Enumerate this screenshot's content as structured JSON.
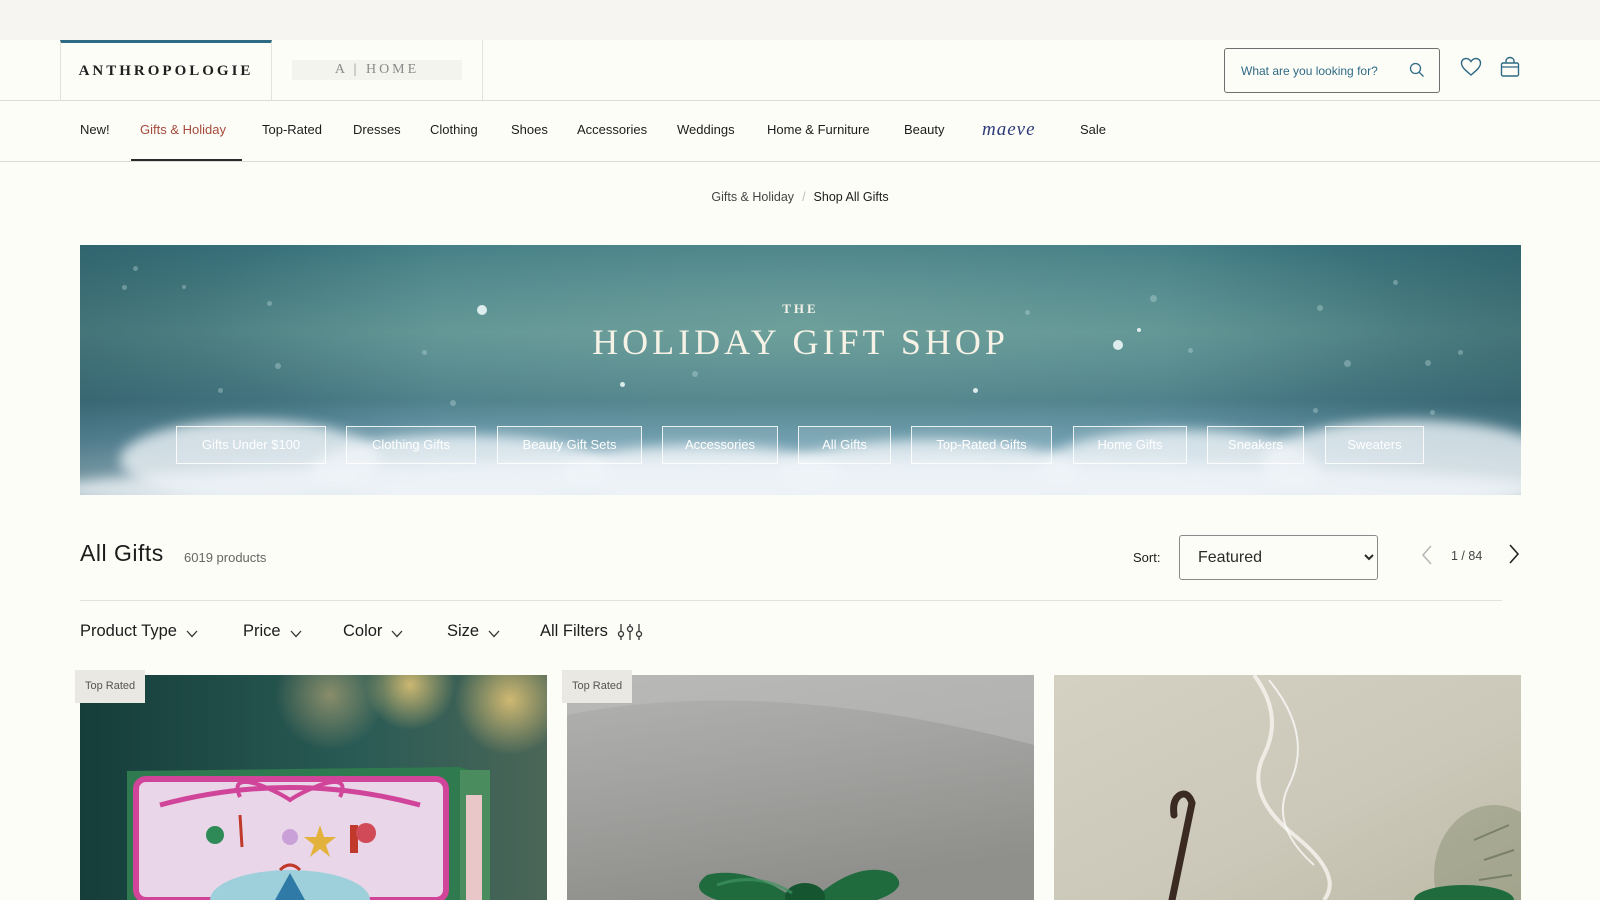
{
  "header": {
    "brand": "ANTHROPOLOGIE",
    "home_brand": "A | HOME",
    "search_placeholder": "What are you looking for?"
  },
  "nav": {
    "items": [
      "New!",
      "Gifts & Holiday",
      "Top-Rated",
      "Dresses",
      "Clothing",
      "Shoes",
      "Accessories",
      "Weddings",
      "Home & Furniture",
      "Beauty",
      "maeve",
      "Sale"
    ],
    "active_index": 1
  },
  "breadcrumb": {
    "items": [
      "Gifts & Holiday",
      "Shop All Gifts"
    ]
  },
  "hero": {
    "eyebrow": "THE",
    "title": "HOLIDAY GIFT SHOP",
    "buttons": [
      "Gifts Under $100",
      "Clothing Gifts",
      "Beauty Gift Sets",
      "Accessories",
      "All Gifts",
      "Top-Rated Gifts",
      "Home Gifts",
      "Sneakers",
      "Sweaters"
    ]
  },
  "results": {
    "title": "All Gifts",
    "count": "6019 products",
    "sort_label": "Sort:",
    "sort_value": "Featured",
    "page": "1 / 84"
  },
  "filters": [
    "Product Type",
    "Price",
    "Color",
    "Size",
    "All Filters"
  ],
  "products": [
    {
      "badge": "Top Rated"
    },
    {
      "badge": "Top Rated"
    },
    {
      "badge": ""
    }
  ],
  "colors": {
    "accent": "#2f6a85",
    "active_nav": "#a64a3b",
    "background": "#fdfdf8"
  }
}
